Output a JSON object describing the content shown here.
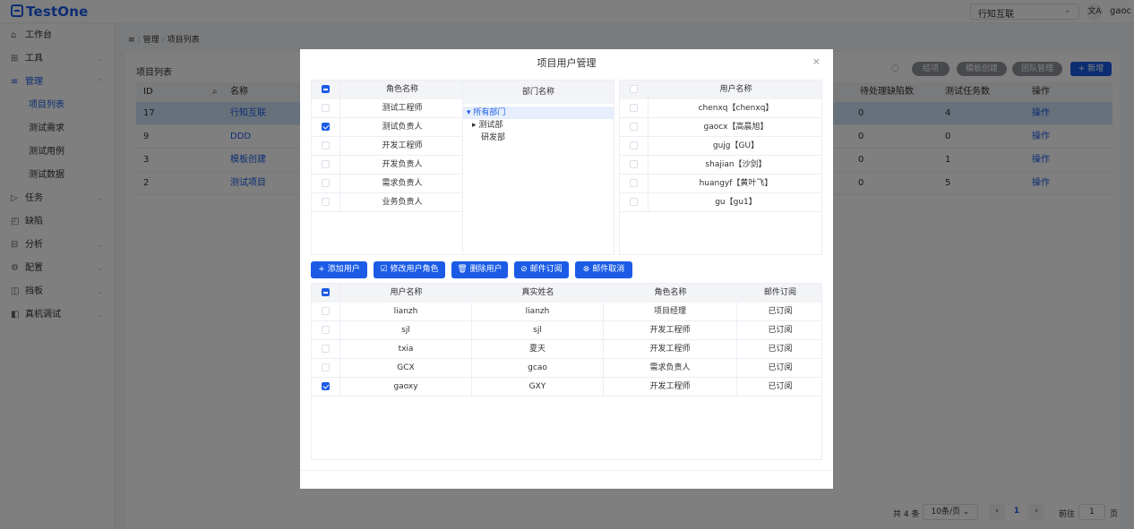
{
  "app": {
    "logo": "TestOne",
    "project_select": "行知互联",
    "lang_icon": "文A",
    "username": "gaoc"
  },
  "sidebar": {
    "items": [
      {
        "label": "工作台",
        "icon": "home-icon",
        "glyph": "⌂",
        "chevron": false
      },
      {
        "label": "工具",
        "icon": "grid-icon",
        "glyph": "⊞",
        "chevron": true
      },
      {
        "label": "管理",
        "icon": "menu-icon",
        "glyph": "≡",
        "chevron": true
      },
      {
        "label": "任务",
        "icon": "play-icon",
        "glyph": "▷",
        "chevron": true
      },
      {
        "label": "缺陷",
        "icon": "bug-icon",
        "glyph": "◰",
        "chevron": false
      },
      {
        "label": "分析",
        "icon": "chart-icon",
        "glyph": "⊟",
        "chevron": true
      },
      {
        "label": "配置",
        "icon": "gear-icon",
        "glyph": "⚙",
        "chevron": true
      },
      {
        "label": "挡板",
        "icon": "board-icon",
        "glyph": "◫",
        "chevron": true
      },
      {
        "label": "真机调试",
        "icon": "device-icon",
        "glyph": "◧",
        "chevron": true
      }
    ],
    "sub_items": [
      "项目列表",
      "测试需求",
      "测试用例",
      "测试数据"
    ]
  },
  "breadcrumb": {
    "menu_icon": "≡",
    "parent": "管理",
    "sep": "/",
    "current": "项目列表"
  },
  "page": {
    "title": "项目列表",
    "refresh_icon": "◌",
    "buttons": {
      "finish": "结项",
      "template": "模板创建",
      "team": "团队管理",
      "add": "+ 新增"
    },
    "table": {
      "headers": {
        "id": "ID",
        "name": "名称",
        "pending": "待处理缺陷数",
        "tasks": "测试任务数",
        "ops": "操作"
      },
      "search_icon": "⌕",
      "rows": [
        {
          "id": "17",
          "name": "行知互联",
          "pending": "0",
          "tasks": "4",
          "ops": "操作"
        },
        {
          "id": "9",
          "name": "DDD",
          "pending": "0",
          "tasks": "0",
          "ops": "操作"
        },
        {
          "id": "3",
          "name": "模板创建",
          "pending": "0",
          "tasks": "1",
          "ops": "操作"
        },
        {
          "id": "2",
          "name": "测试项目",
          "pending": "0",
          "tasks": "5",
          "ops": "操作"
        }
      ]
    },
    "pager": {
      "total": "共 4 条",
      "page_size": "10条/页",
      "prev": "‹",
      "current": "1",
      "next": "›",
      "goto": "前往",
      "goto_value": "1",
      "page_suffix": "页"
    }
  },
  "modal": {
    "title": "项目用户管理",
    "close": "×",
    "roles": {
      "header": "角色名称",
      "items": [
        {
          "label": "测试工程师",
          "checked": false
        },
        {
          "label": "测试负责人",
          "checked": true
        },
        {
          "label": "开发工程师",
          "checked": false
        },
        {
          "label": "开发负责人",
          "checked": false
        },
        {
          "label": "需求负责人",
          "checked": false
        },
        {
          "label": "业务负责人",
          "checked": false
        }
      ]
    },
    "dept": {
      "header": "部门名称",
      "nodes": [
        {
          "label": "所有部门",
          "arrow": "▾",
          "level": 0,
          "selected": true
        },
        {
          "label": "测试部",
          "arrow": "▸",
          "level": 1,
          "selected": false
        },
        {
          "label": "研发部",
          "arrow": "",
          "level": 1,
          "selected": false
        }
      ]
    },
    "users": {
      "header": "用户名称",
      "items": [
        "chenxq【chenxq】",
        "gaocx【高晨旭】",
        "gujg【GU】",
        "shajian【沙剑】",
        "huangyf【黄叶飞】",
        "gu【gu1】"
      ]
    },
    "actions": [
      {
        "label": "+ 添加用户",
        "name": "add-user-button"
      },
      {
        "label": "☑ 修改用户角色",
        "name": "edit-user-role-button"
      },
      {
        "label": "🗑 删除用户",
        "name": "delete-user-button"
      },
      {
        "label": "⊘ 邮件订阅",
        "name": "mail-subscribe-button"
      },
      {
        "label": "⊗ 邮件取消",
        "name": "mail-unsubscribe-button"
      }
    ],
    "members": {
      "headers": {
        "user": "用户名称",
        "real": "真实姓名",
        "role": "角色名称",
        "mail": "邮件订阅"
      },
      "rows": [
        {
          "user": "lianzh",
          "real": "lianzh",
          "role": "项目经理",
          "mail": "已订阅",
          "checked": false
        },
        {
          "user": "sjl",
          "real": "sjl",
          "role": "开发工程师",
          "mail": "已订阅",
          "checked": false
        },
        {
          "user": "txia",
          "real": "夏天",
          "role": "开发工程师",
          "mail": "已订阅",
          "checked": false
        },
        {
          "user": "GCX",
          "real": "gcao",
          "role": "需求负责人",
          "mail": "已订阅",
          "checked": false
        },
        {
          "user": "gaoxy",
          "real": "GXY",
          "role": "开发工程师",
          "mail": "已订阅",
          "checked": true
        }
      ]
    }
  }
}
